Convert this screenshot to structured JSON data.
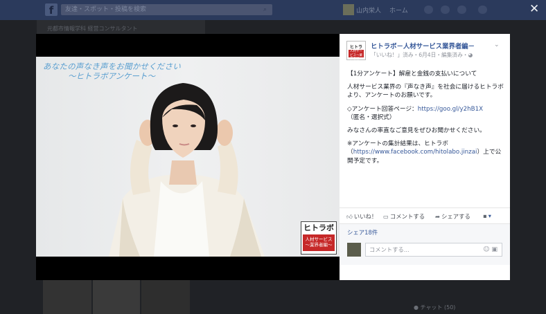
{
  "background": {
    "search_placeholder": "友達・スポット・投稿を検索",
    "username": "山内栄人",
    "home": "ホーム",
    "left_text": "元都市情報学科 経営コンサルタント",
    "chat": "● チャット (50)"
  },
  "photo": {
    "title_line1": "あなたの声なき声をお聞かせください",
    "title_line2": "～ヒトラボアンケート～",
    "stamp_top": "ヒトラボ",
    "stamp_bottom": "人材サービス\n～業界者編～"
  },
  "post": {
    "avatar_top": "ヒトラボ",
    "avatar_bottom": "人材サービス～業界者編～",
    "page_name": "ヒトラボ－人材サービス業界者編－",
    "meta": "「いいね！」済み・6月4日・編集済み・",
    "paragraphs": [
      "【1分アンケート】解雇と金銭の支払いについて",
      "人材サービス業界の『声なき声』を社会に届けるヒトラボより、アンケートのお願いです。"
    ],
    "survey_label": "◇アンケート回答ページ：",
    "survey_link": "https://goo.gl/y2hB1X",
    "survey_note": "（匿名・選択式）",
    "paragraph_request": "みなさんの率直なご意見をぜひお聞かせください。",
    "result_prefix": "※アンケートの集計結果は、ヒトラボ（",
    "result_link": "https://www.facebook.com/hitolabo.jinzai",
    "result_suffix": "）上で公開予定です。"
  },
  "actions": {
    "like": "いいね！",
    "comment": "コメントする",
    "share": "シェアする"
  },
  "shares": "シェア18件",
  "comment_placeholder": "コメントする...",
  "icons": {
    "close": "close-icon",
    "like": "thumbs-up-icon",
    "comment": "speech-bubble-icon",
    "share": "share-arrow-icon"
  }
}
